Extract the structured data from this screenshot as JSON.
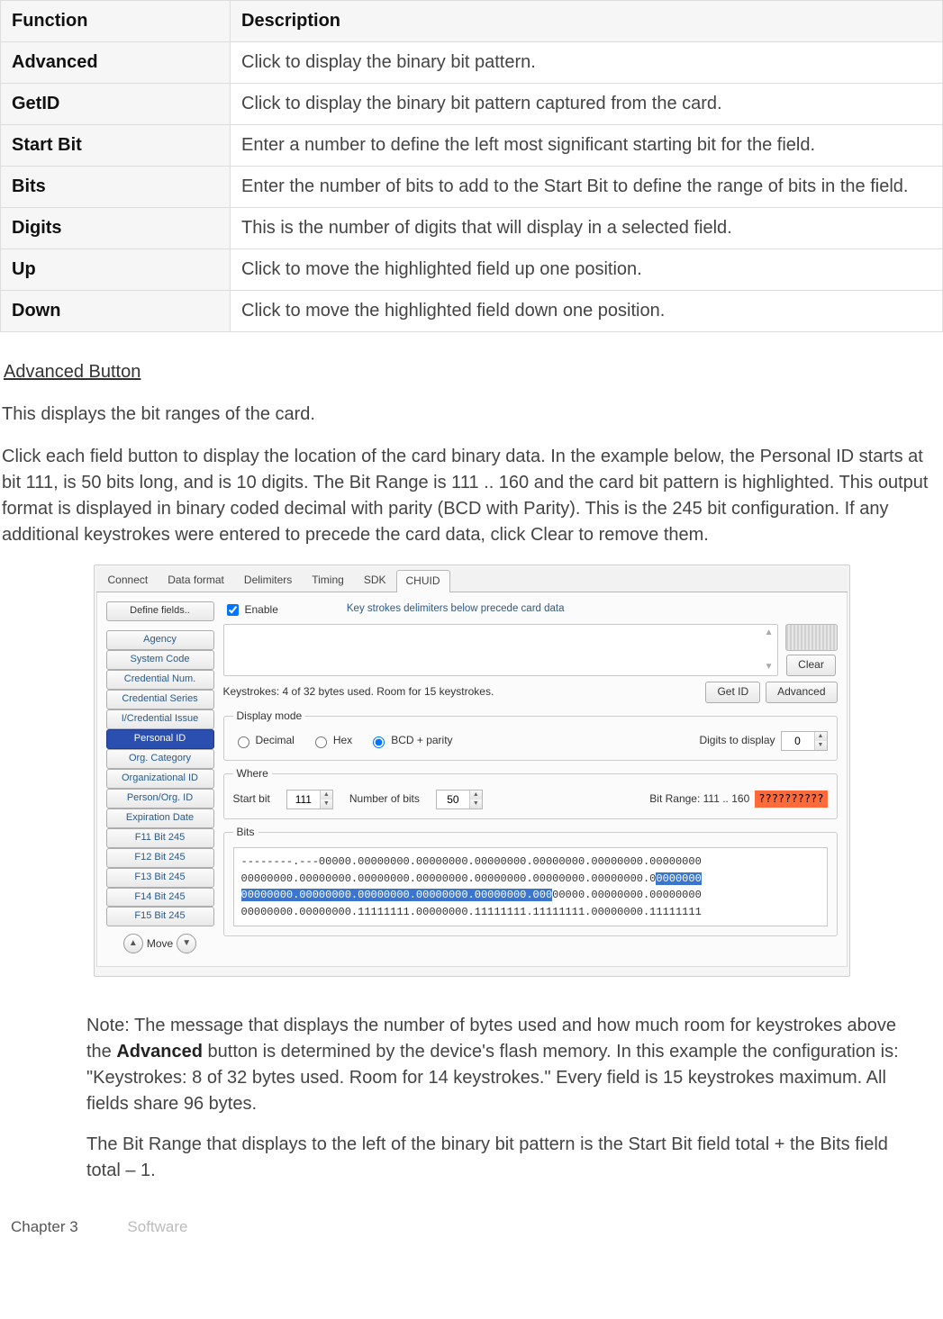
{
  "table": {
    "head": {
      "fn": "Function",
      "desc": "Description"
    },
    "rows": [
      {
        "fn": "Advanced",
        "desc": "Click to display the binary bit pattern."
      },
      {
        "fn": "GetID",
        "desc": "Click to display the binary bit pattern captured from the card."
      },
      {
        "fn": "Start Bit",
        "desc": "Enter a number to define the left most significant starting bit for the field."
      },
      {
        "fn": "Bits",
        "desc": "Enter the number of bits to add to the Start Bit to define the range of bits in the field."
      },
      {
        "fn": "Digits",
        "desc": "This is the number of digits that will display in a selected field."
      },
      {
        "fn": "Up",
        "desc": "Click to move the highlighted field up one position."
      },
      {
        "fn": "Down",
        "desc": "Click to move the highlighted field down one position."
      }
    ]
  },
  "section": {
    "heading": "Advanced Button",
    "p1": "This displays the bit ranges of the card.",
    "p2": "Click each field button to display the location of the card binary data. In the example below, the Personal ID starts at bit 111, is 50 bits long, and is 10 digits. The Bit Range is 111 .. 160 and the card bit pattern is highlighted. This output format is displayed in binary coded decimal with parity (BCD with Parity). This is the 245 bit configuration. If any additional keystrokes were entered to precede the card data, click Clear to remove them."
  },
  "shot": {
    "tabs": [
      "Connect",
      "Data format",
      "Delimiters",
      "Timing",
      "SDK",
      "CHUID"
    ],
    "active_tab": "CHUID",
    "define_fields": "Define fields..",
    "fields": [
      "Agency",
      "System Code",
      "Credential Num.",
      "Credential Series",
      "I/Credential Issue",
      "Personal ID",
      "Org. Category",
      "Organizational ID",
      "Person/Org. ID",
      "Expiration Date",
      "F11 Bit 245",
      "F12 Bit 245",
      "F13 Bit 245",
      "F14 Bit 245",
      "F15 Bit 245"
    ],
    "selected_field": "Personal ID",
    "move_label": "Move",
    "enable_label": "Enable",
    "enable_checked": true,
    "precede_note": "Key strokes delimiters below precede card data",
    "clear_btn": "Clear",
    "ks_label": "Keystrokes: 4 of 32 bytes used. Room for 15 keystrokes.",
    "getid_btn": "Get ID",
    "adv_btn": "Advanced",
    "display_mode": {
      "legend": "Display mode",
      "opts": [
        "Decimal",
        "Hex",
        "BCD + parity"
      ],
      "selected": "BCD + parity",
      "digits_label": "Digits to display",
      "digits_value": "0"
    },
    "where": {
      "legend": "Where",
      "start_label": "Start bit",
      "start_value": "111",
      "nbits_label": "Number of bits",
      "nbits_value": "50",
      "range_label": "Bit Range: 111 .. 160",
      "qmarks": "??????????"
    },
    "bits": {
      "legend": "Bits",
      "line1_a": "--------.---00000.00000000.00000000.00000000.00000000.00000000.00000000",
      "line2_a": "00000000.00000000.00000000.00000000.00000000.00000000.00000000.0",
      "line2_hl": "0000000",
      "line3_hl": "00000000.00000000.00000000.00000000.00000000.000",
      "line3_b": "00000.00000000.00000000",
      "line4": "00000000.00000000.11111111.00000000.11111111.11111111.00000000.11111111"
    }
  },
  "notes": {
    "p1a": "Note: The message that displays the number of bytes used and how much room for keystrokes above the ",
    "p1b": "Advanced",
    "p1c": " button is determined by the device's flash memory. In this example the configuration is: \"Keystrokes: 8 of 32 bytes used. Room for 14 keystrokes.\" Every field is 15 keystrokes maximum. All fields share 96 bytes.",
    "p2": "The Bit Range that displays to the left of the binary bit pattern is the Start Bit field total + the Bits field total – 1."
  },
  "footer": {
    "chapter": "Chapter 3",
    "sw": "Software"
  }
}
